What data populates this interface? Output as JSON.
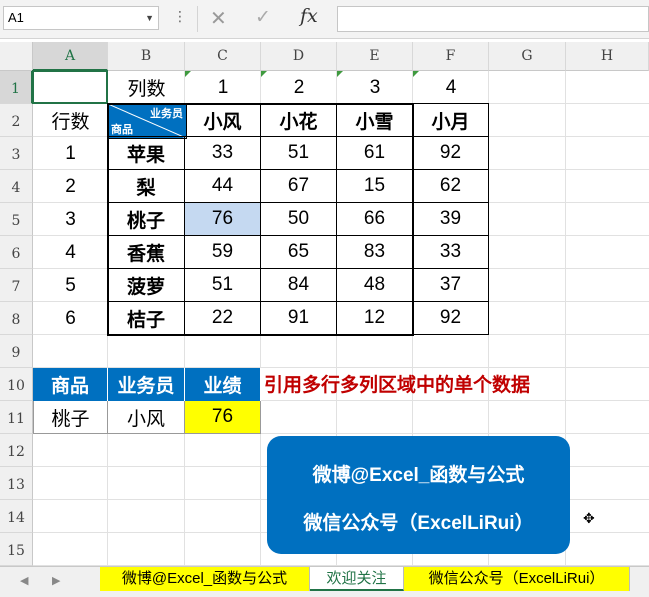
{
  "formula_bar": {
    "name_box": "A1",
    "dots": "⋮",
    "cancel_icon": "✕",
    "enter_icon": "✓",
    "fx_label": "fx"
  },
  "columns": [
    "A",
    "B",
    "C",
    "D",
    "E",
    "F",
    "G",
    "H"
  ],
  "rows": [
    "1",
    "2",
    "3",
    "4",
    "5",
    "6",
    "7",
    "8",
    "9",
    "10",
    "11",
    "12",
    "13",
    "14",
    "15"
  ],
  "row1": {
    "b": "列数",
    "c": "1",
    "d": "2",
    "e": "3",
    "f": "4"
  },
  "row_index_label": "行数",
  "row_numbers": [
    "1",
    "2",
    "3",
    "4",
    "5",
    "6"
  ],
  "header_corner": {
    "top": "业务员",
    "bottom": "商品"
  },
  "salespeople": [
    "小风",
    "小花",
    "小雪",
    "小月"
  ],
  "products": [
    "苹果",
    "梨",
    "桃子",
    "香蕉",
    "菠萝",
    "桔子"
  ],
  "values": [
    [
      33,
      51,
      61,
      92
    ],
    [
      44,
      67,
      15,
      62
    ],
    [
      76,
      50,
      66,
      39
    ],
    [
      59,
      65,
      83,
      33
    ],
    [
      51,
      84,
      48,
      37
    ],
    [
      22,
      91,
      12,
      92
    ]
  ],
  "lookup": {
    "headers": [
      "商品",
      "业务员",
      "业绩"
    ],
    "product": "桃子",
    "salesperson": "小风",
    "result": "76"
  },
  "annotation": "引用多行多列区域中的单个数据",
  "promo": {
    "line1": "微博@Excel_函数与公式",
    "line2": "微信公众号（ExcelLiRui）"
  },
  "sheet_tabs": [
    "微博@Excel_函数与公式",
    "欢迎关注",
    "微信公众号（ExcelLiRui）"
  ],
  "colors": {
    "header_blue": "#0070c0",
    "highlight_yellow": "#ffff00",
    "highlight_cell": "#c5d9f1",
    "annotation_red": "#c00000",
    "excel_green": "#217346"
  }
}
